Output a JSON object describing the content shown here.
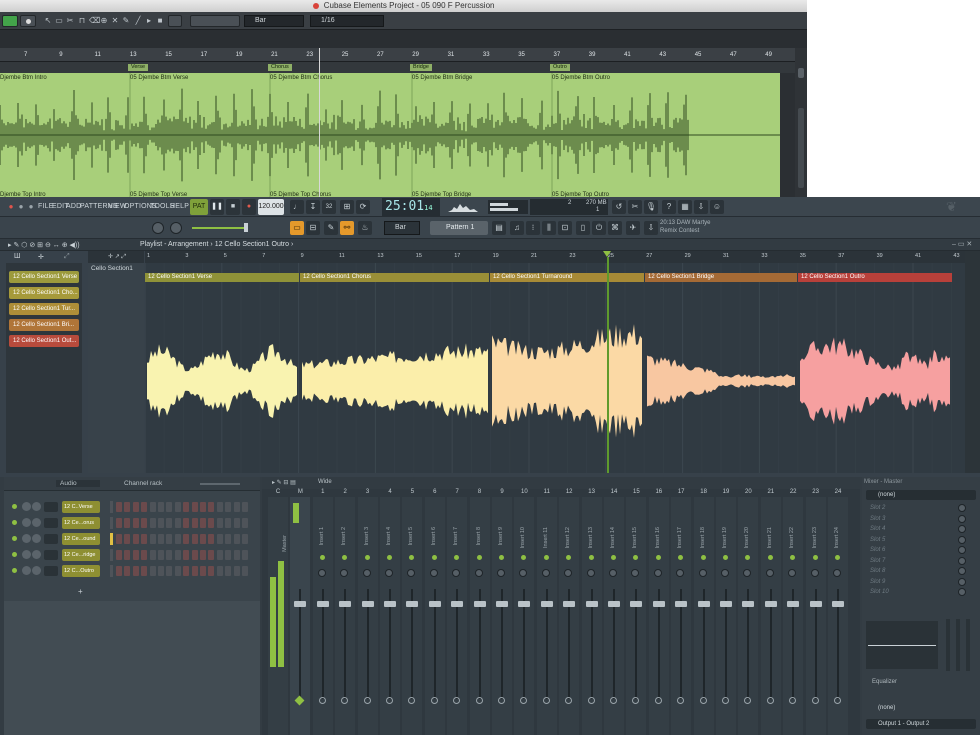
{
  "cubase": {
    "title": "Cubase Elements Project - 05 090 F Percussion",
    "quantize_mode": "Bar",
    "quantize_value": "1/16",
    "ruler_ticks": [
      "7",
      "9",
      "11",
      "13",
      "15",
      "17",
      "19",
      "21",
      "23",
      "25",
      "27",
      "29",
      "31",
      "33",
      "35",
      "37",
      "39",
      "41",
      "43",
      "45",
      "47",
      "49"
    ],
    "markers": [
      {
        "label": "Verse"
      },
      {
        "label": "Chorus"
      },
      {
        "label": "Bridge"
      },
      {
        "label": "Outro"
      }
    ],
    "events_top": [
      "Djembe Btm Intro",
      "05 Djembe Btm Verse",
      "05 Djembe Btm Chorus",
      "05 Djembe Btm Bridge",
      "05 Djembe Btm Outro"
    ],
    "events_bottom": [
      "Djembe Top Intro",
      "05 Djembe Top Verse",
      "05 Djembe Top Chorus",
      "05 Djembe Top Bridge",
      "05 Djembe Top Outro"
    ]
  },
  "fl": {
    "menu": [
      "FILE",
      "EDIT",
      "ADD",
      "PATTERNS",
      "VIEW",
      "OPTIONS",
      "TOOLS",
      "HELP"
    ],
    "tempo": "120.000",
    "time": "25:01",
    "time_sub": "14",
    "cpu_mem": "270 MB",
    "cpu_val": "2",
    "cpu_val2": "1",
    "pattern": "Pattern 1",
    "snap": "Bar",
    "hint_line1": "20:13  DAW Martye",
    "hint_line2": "Remix Contest",
    "playlist_breadcrumb": "Playlist - Arrangement › 12 Cello Section1 Outro ›",
    "picker_clips": [
      {
        "label": "12 Cello Section1 Verse",
        "color": "#9c9a3c"
      },
      {
        "label": "12 Cello Section1 Cho...",
        "color": "#a69a3a"
      },
      {
        "label": "12 Cello Section1 Tur...",
        "color": "#ae8e38"
      },
      {
        "label": "12 Cello Section1 Bri...",
        "color": "#b07538"
      },
      {
        "label": "12 Cello Section1 Out...",
        "color": "#b84b3c"
      }
    ],
    "track_name": "Cello Section1",
    "ruler_ticks": [
      "1",
      "3",
      "5",
      "7",
      "9",
      "11",
      "13",
      "15",
      "17",
      "19",
      "21",
      "23",
      "25",
      "27",
      "29",
      "31",
      "33",
      "35",
      "37",
      "39",
      "41",
      "43"
    ],
    "playlist_clips": [
      {
        "label": "12 Cello Section1 Verse",
        "color": "#8f9238",
        "wave": "#f9f3b0"
      },
      {
        "label": "12 Cello Section1 Chorus",
        "color": "#9a8f37",
        "wave": "#fbeeaa"
      },
      {
        "label": "12 Cello Section1 Turnaround",
        "color": "#a78a36",
        "wave": "#fbd9a5"
      },
      {
        "label": "12 Cello Section1 Bridge",
        "color": "#a56a35",
        "wave": "#f8c7a1"
      },
      {
        "label": "12 Cello Section1 Outro",
        "color": "#b8403a",
        "wave": "#f6a0a0"
      }
    ],
    "channel_rack": {
      "title": "Channel rack",
      "filter": "Audio",
      "channels": [
        "12 C..Verse",
        "12 Ce...orus",
        "12 Ce...ound",
        "12 Ce...ridge",
        "12 C...Outro"
      ]
    },
    "mixer": {
      "title": "Wide",
      "master_label": "Master",
      "insert_prefix": "Insert",
      "numbers": [
        "C",
        "M",
        "1",
        "2",
        "3",
        "4",
        "5",
        "6",
        "7",
        "8",
        "9",
        "10",
        "11",
        "12",
        "13",
        "14",
        "15",
        "16",
        "17",
        "18",
        "19",
        "20",
        "21",
        "22",
        "23",
        "24"
      ]
    },
    "mixer_panel": {
      "title": "Mixer - Master",
      "input": "(none)",
      "slots": [
        "Slot 2",
        "Slot 3",
        "Slot 4",
        "Slot 5",
        "Slot 6",
        "Slot 7",
        "Slot 8",
        "Slot 9",
        "Slot 10"
      ],
      "eq_label": "Equalizer",
      "bottom_input": "(none)",
      "output": "Output 1 - Output 2"
    }
  }
}
